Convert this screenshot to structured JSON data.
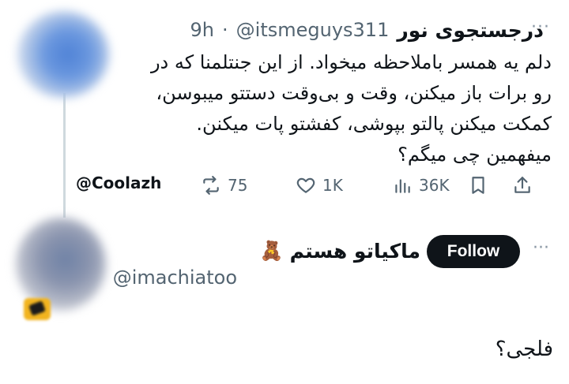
{
  "tweet": {
    "display_name": "درجستجوی نور",
    "handle": "@itsmeguys311",
    "dot": "·",
    "time": "9h",
    "more_label": "···",
    "text_lines": [
      "دلم یه همسر باملاحظه میخواد. از این جنتلمنا که در",
      "رو برات باز میکنن، وقت و بی‌وقت دستتو میبوسن،",
      "کمکت میکنن پالتو بپوشی، کفشتو پات میکنن.",
      "میفهمین چی میگم؟"
    ],
    "watermark": "@Coolazh",
    "actions": {
      "retweet_count": "75",
      "like_count": "1K",
      "views_count": "36K"
    },
    "icons": {
      "retweet": "retweet-icon",
      "like": "heart-icon",
      "views": "views-chart-icon",
      "bookmark": "bookmark-icon",
      "share": "share-icon"
    }
  },
  "reply": {
    "display_name": "ماکیاتو هستم",
    "emoji": "🧸",
    "handle": "@imachiatoo",
    "follow_label": "Follow",
    "more_label": "···",
    "text": "فلجی؟"
  },
  "colors": {
    "text": "#0f1419",
    "secondary": "#536471",
    "thread_line": "#cfd9de",
    "follow_bg": "#0f1419"
  }
}
